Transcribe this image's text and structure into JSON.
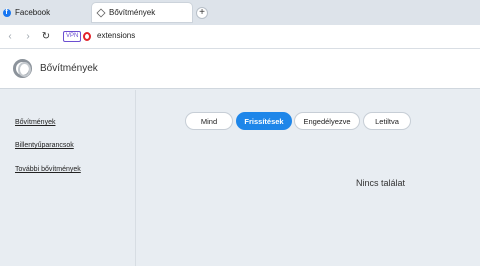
{
  "tabs": [
    {
      "label": "Facebook",
      "icon": "facebook-icon"
    },
    {
      "label": "Bővítmények",
      "icon": "extension-cube-icon"
    }
  ],
  "new_tab_label": "+",
  "address_bar": {
    "vpn_badge": "VPN",
    "url": "extensions"
  },
  "page": {
    "title": "Bővítmények"
  },
  "sidebar": {
    "items": [
      {
        "label": "Bővítmények"
      },
      {
        "label": "Billentyűparancsok"
      },
      {
        "label": "További bővítmények"
      }
    ]
  },
  "filters": {
    "items": [
      {
        "label": "Mind",
        "active": false
      },
      {
        "label": "Frissítések",
        "active": true
      },
      {
        "label": "Engedélyezve",
        "active": false
      },
      {
        "label": "Letiltva",
        "active": false
      }
    ]
  },
  "empty_state": "Nincs találat",
  "colors": {
    "accent": "#1e86e9",
    "background": "#e8edf2"
  }
}
